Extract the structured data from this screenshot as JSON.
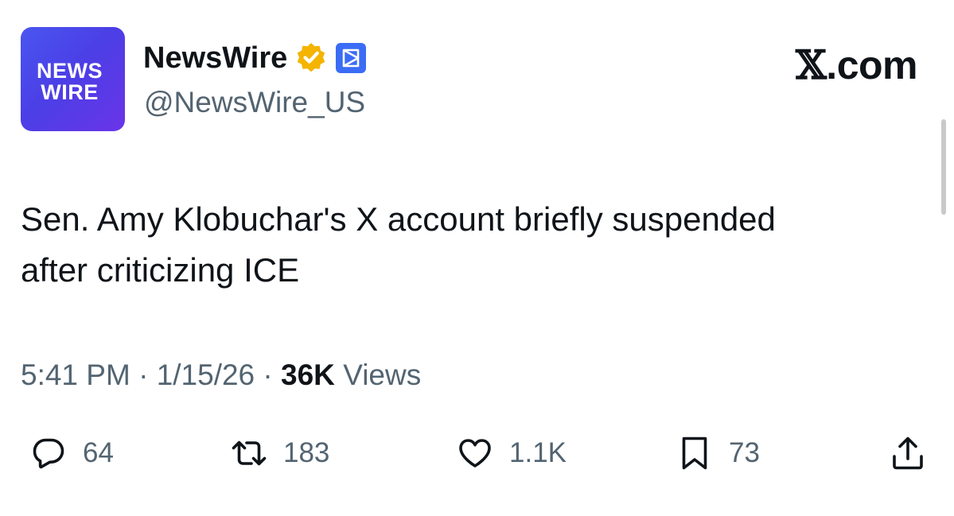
{
  "author": {
    "avatar_line1": "NEWS",
    "avatar_line2": "WIRE",
    "display_name": "NewsWire",
    "handle": "@NewsWire_US",
    "verified_badge_color": "#f4b400",
    "affiliate_badge_color": "#3b6cf6",
    "avatar_gradient": [
      "#4a56f0",
      "#6a34e8"
    ]
  },
  "brand": {
    "x_glyph": "𝕏",
    "suffix": ".com"
  },
  "tweet": {
    "line1": "Sen. Amy Klobuchar's X account briefly suspended",
    "line2": "after criticizing ICE",
    "time": "5:41 PM",
    "sep1": " · ",
    "date": "1/15/26",
    "sep2": " · ",
    "views_count": "36K",
    "views_label": " Views"
  },
  "actions": {
    "reply_count": "64",
    "repost_count": "183",
    "like_count": "1.1K",
    "bookmark_count": "73"
  },
  "icons": {
    "reply": "reply-icon",
    "repost": "repost-icon",
    "like": "heart-icon",
    "bookmark": "bookmark-icon",
    "share": "share-icon",
    "verified": "verified-badge-icon",
    "affiliate": "affiliate-badge-icon"
  },
  "colors": {
    "text_primary": "#0f1419",
    "text_secondary": "#536471"
  }
}
